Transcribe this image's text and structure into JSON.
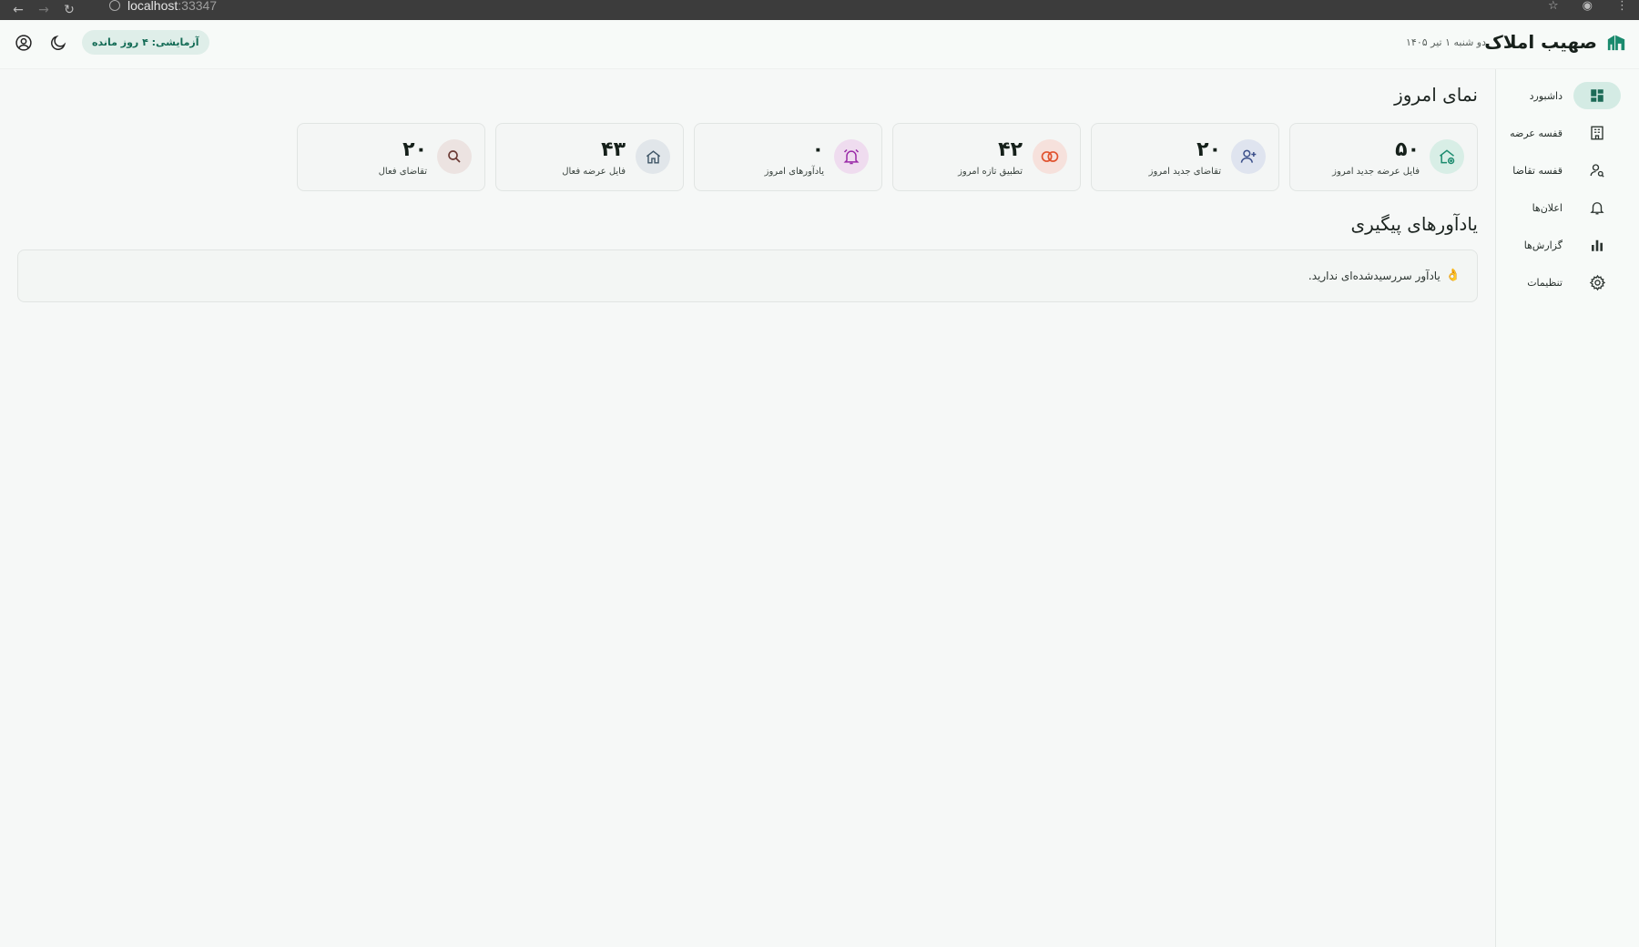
{
  "browser": {
    "url_host": "localhost",
    "url_port": ":33347"
  },
  "header": {
    "app_name": "صهیب املاک",
    "date": "دو شنبه ۱ تیر ۱۴۰۵",
    "trial_badge": "آزمایشی: ۴ روز مانده",
    "brand_color": "#1a8a6d"
  },
  "sidebar": {
    "items": [
      {
        "label": "داشبورد",
        "icon": "dashboard-icon",
        "active": true
      },
      {
        "label": "قفسه عرضه",
        "icon": "building-icon",
        "active": false
      },
      {
        "label": "قفسه تقاضا",
        "icon": "person-search-icon",
        "active": false
      },
      {
        "label": "اعلان‌ها",
        "icon": "bell-icon",
        "active": false
      },
      {
        "label": "گزارش‌ها",
        "icon": "bar-chart-icon",
        "active": false
      },
      {
        "label": "تنظیمات",
        "icon": "gear-icon",
        "active": false
      }
    ]
  },
  "main": {
    "today_title": "نمای امروز",
    "stats": [
      {
        "value": "۵۰",
        "label": "فایل عرضه جدید امروز",
        "icon": "home-add-icon",
        "bg": "#d8eee6",
        "fg": "#1a8a6d"
      },
      {
        "value": "۲۰",
        "label": "تقاضای جدید امروز",
        "icon": "person-add-icon",
        "bg": "#dfe4ef",
        "fg": "#3b4f8a"
      },
      {
        "value": "۴۲",
        "label": "تطبیق تازه امروز",
        "icon": "match-icon",
        "bg": "#f6e1dc",
        "fg": "#e0532f"
      },
      {
        "value": "۰",
        "label": "یادآورهای امروز",
        "icon": "alarm-icon",
        "bg": "#efdcef",
        "fg": "#9a2aa8"
      },
      {
        "value": "۴۳",
        "label": "فایل عرضه فعال",
        "icon": "home-icon",
        "bg": "#e1e6ea",
        "fg": "#3f5566"
      },
      {
        "value": "۲۰",
        "label": "تقاضای فعال",
        "icon": "search-icon",
        "bg": "#ece3e1",
        "fg": "#6b3a34"
      }
    ],
    "reminders_title": "یادآورهای پیگیری",
    "reminders_empty": "یادآور سررسیدشده‌ای ندارید."
  }
}
